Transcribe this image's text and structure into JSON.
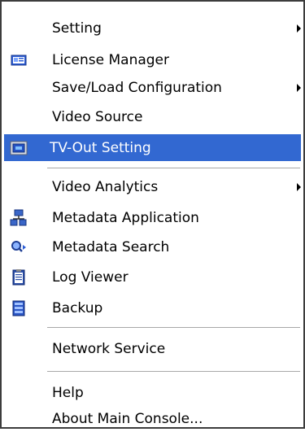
{
  "menu": {
    "items": [
      {
        "label": "Setting"
      },
      {
        "label": "License Manager",
        "icon": "license-card-icon"
      },
      {
        "label": "Save/Load Configuration"
      },
      {
        "label": "Video Source"
      },
      {
        "label": "TV-Out Setting",
        "icon": "tv-monitor-icon"
      },
      {
        "label": "Video Analytics"
      },
      {
        "label": "Metadata Application",
        "icon": "network-computers-icon"
      },
      {
        "label": "Metadata Search",
        "icon": "search-magnifier-icon"
      },
      {
        "label": "Log Viewer",
        "icon": "clipboard-log-icon"
      },
      {
        "label": "Backup",
        "icon": "backup-list-icon"
      },
      {
        "label": "Network Service"
      },
      {
        "label": "Help"
      },
      {
        "label": "About Main Console..."
      }
    ],
    "selected_color": "#3268d1"
  }
}
